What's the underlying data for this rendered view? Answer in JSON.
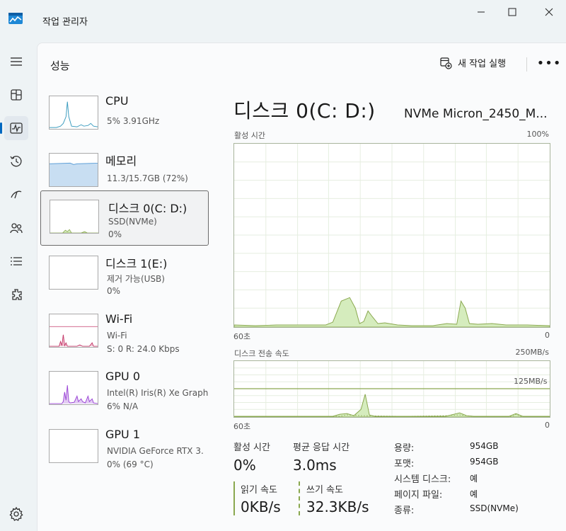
{
  "app": {
    "title": "작업 관리자"
  },
  "header": {
    "page_title": "성능",
    "new_task_label": "새 작업 실행"
  },
  "nav": {
    "items": [
      "hamburger-icon",
      "processes-icon",
      "performance-icon",
      "app-history-icon",
      "startup-icon",
      "users-icon",
      "details-icon",
      "services-icon"
    ],
    "active": "performance-icon"
  },
  "devices": [
    {
      "name": "CPU",
      "sub1": "5% 3.91GHz",
      "sub2": ""
    },
    {
      "name": "메모리",
      "sub1": "11.3/15.7GB (72%)",
      "sub2": ""
    },
    {
      "name": "디스크 0(C: D:)",
      "sub1": "SSD(NVMe)",
      "sub2": "0%"
    },
    {
      "name": "디스크 1(E:)",
      "sub1": "제거 가능(USB)",
      "sub2": "0%"
    },
    {
      "name": "Wi-Fi",
      "sub1": "Wi-Fi",
      "sub2": "S: 0 R: 24.0 Kbps"
    },
    {
      "name": "GPU 0",
      "sub1": "Intel(R) Iris(R) Xe Graph",
      "sub2": "6% N/A"
    },
    {
      "name": "GPU 1",
      "sub1": "NVIDIA GeForce RTX 3.",
      "sub2": "0% (69 °C)"
    }
  ],
  "selected_device": 2,
  "detail": {
    "title": "디스크 0(C: D:)",
    "model": "NVMe Micron_2450_M...",
    "graph1": {
      "label": "활성 시간",
      "max": "100%",
      "time": "60초",
      "min": "0"
    },
    "graph2": {
      "label": "디스크 전송 속도",
      "max": "250MB/s",
      "mid": "125MB/s",
      "time": "60초",
      "min": "0"
    },
    "stats": {
      "active_time_label": "활성 시간",
      "active_time_value": "0%",
      "avg_response_label": "평균 응답 시간",
      "avg_response_value": "3.0ms",
      "read_label": "읽기 속도",
      "read_value": "0KB/s",
      "write_label": "쓰기 속도",
      "write_value": "32.3KB/s"
    },
    "props": [
      {
        "k": "용량:",
        "v": "954GB"
      },
      {
        "k": "포맷:",
        "v": "954GB"
      },
      {
        "k": "시스템 디스크:",
        "v": "예"
      },
      {
        "k": "페이지 파일:",
        "v": "예"
      },
      {
        "k": "종류:",
        "v": "SSD(NVMe)"
      }
    ]
  },
  "colors": {
    "accent": "#0067c0",
    "disk": "#8aa84f",
    "disk_fill": "#d5ecbd",
    "memory": "#5fa0d8",
    "wifi": "#c43b6b",
    "gpu": "#9b45d6",
    "cpu": "#3b9cbf"
  }
}
